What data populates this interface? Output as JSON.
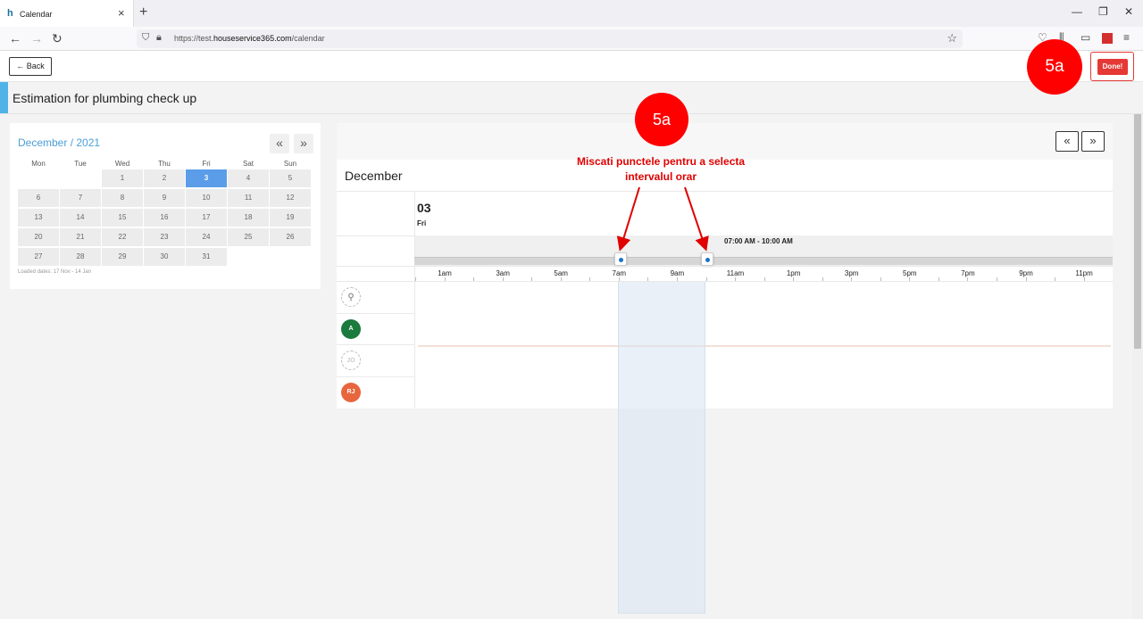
{
  "browser": {
    "tab_title": "Calendar",
    "tab_favicon": "h",
    "new_tab": "+",
    "tab_close": "×",
    "url_prefix": "https://test.",
    "url_domain": "houseservice365.com",
    "url_path": "/calendar"
  },
  "header": {
    "back_label": "Back",
    "done_label": "Done!",
    "page_title": "Estimation for plumbing check up"
  },
  "mini_calendar": {
    "month_title": "December / 2021",
    "prev": "«",
    "next": "»",
    "weekdays": [
      "Mon",
      "Tue",
      "Wed",
      "Thu",
      "Fri",
      "Sat",
      "Sun"
    ],
    "weeks": [
      [
        "",
        "",
        "1",
        "2",
        "3",
        "4",
        "5"
      ],
      [
        "6",
        "7",
        "8",
        "9",
        "10",
        "11",
        "12"
      ],
      [
        "13",
        "14",
        "15",
        "16",
        "17",
        "18",
        "19"
      ],
      [
        "20",
        "21",
        "22",
        "23",
        "24",
        "25",
        "26"
      ],
      [
        "27",
        "28",
        "29",
        "30",
        "31",
        "",
        ""
      ]
    ],
    "selected_day": "3",
    "loaded_dates": "Loaded dates: 17 Nov - 14 Jan"
  },
  "scheduler": {
    "month": "December",
    "day_number": "03",
    "day_name": "Fri",
    "range_label": "07:00 AM - 10:00 AM",
    "hour_labels": [
      "1am",
      "3am",
      "5am",
      "7am",
      "9am",
      "11am",
      "1pm",
      "3pm",
      "5pm",
      "7pm",
      "9pm",
      "11pm"
    ],
    "prev_arrow": "«",
    "next_arrow": "»",
    "staff": [
      {
        "initials": "",
        "color": "#ffffff",
        "icon": "unassigned-icon"
      },
      {
        "initials": "A",
        "color": "#1b7a3e"
      },
      {
        "initials": "JO",
        "color": "#ffffff"
      },
      {
        "initials": "RJ",
        "color": "#e8663d"
      }
    ]
  },
  "annotations": {
    "badge_top": "5a",
    "badge_center": "5a",
    "instruction": "Miscati punctele pentru a selecta intervalul orar",
    "color": "#ff0000"
  }
}
